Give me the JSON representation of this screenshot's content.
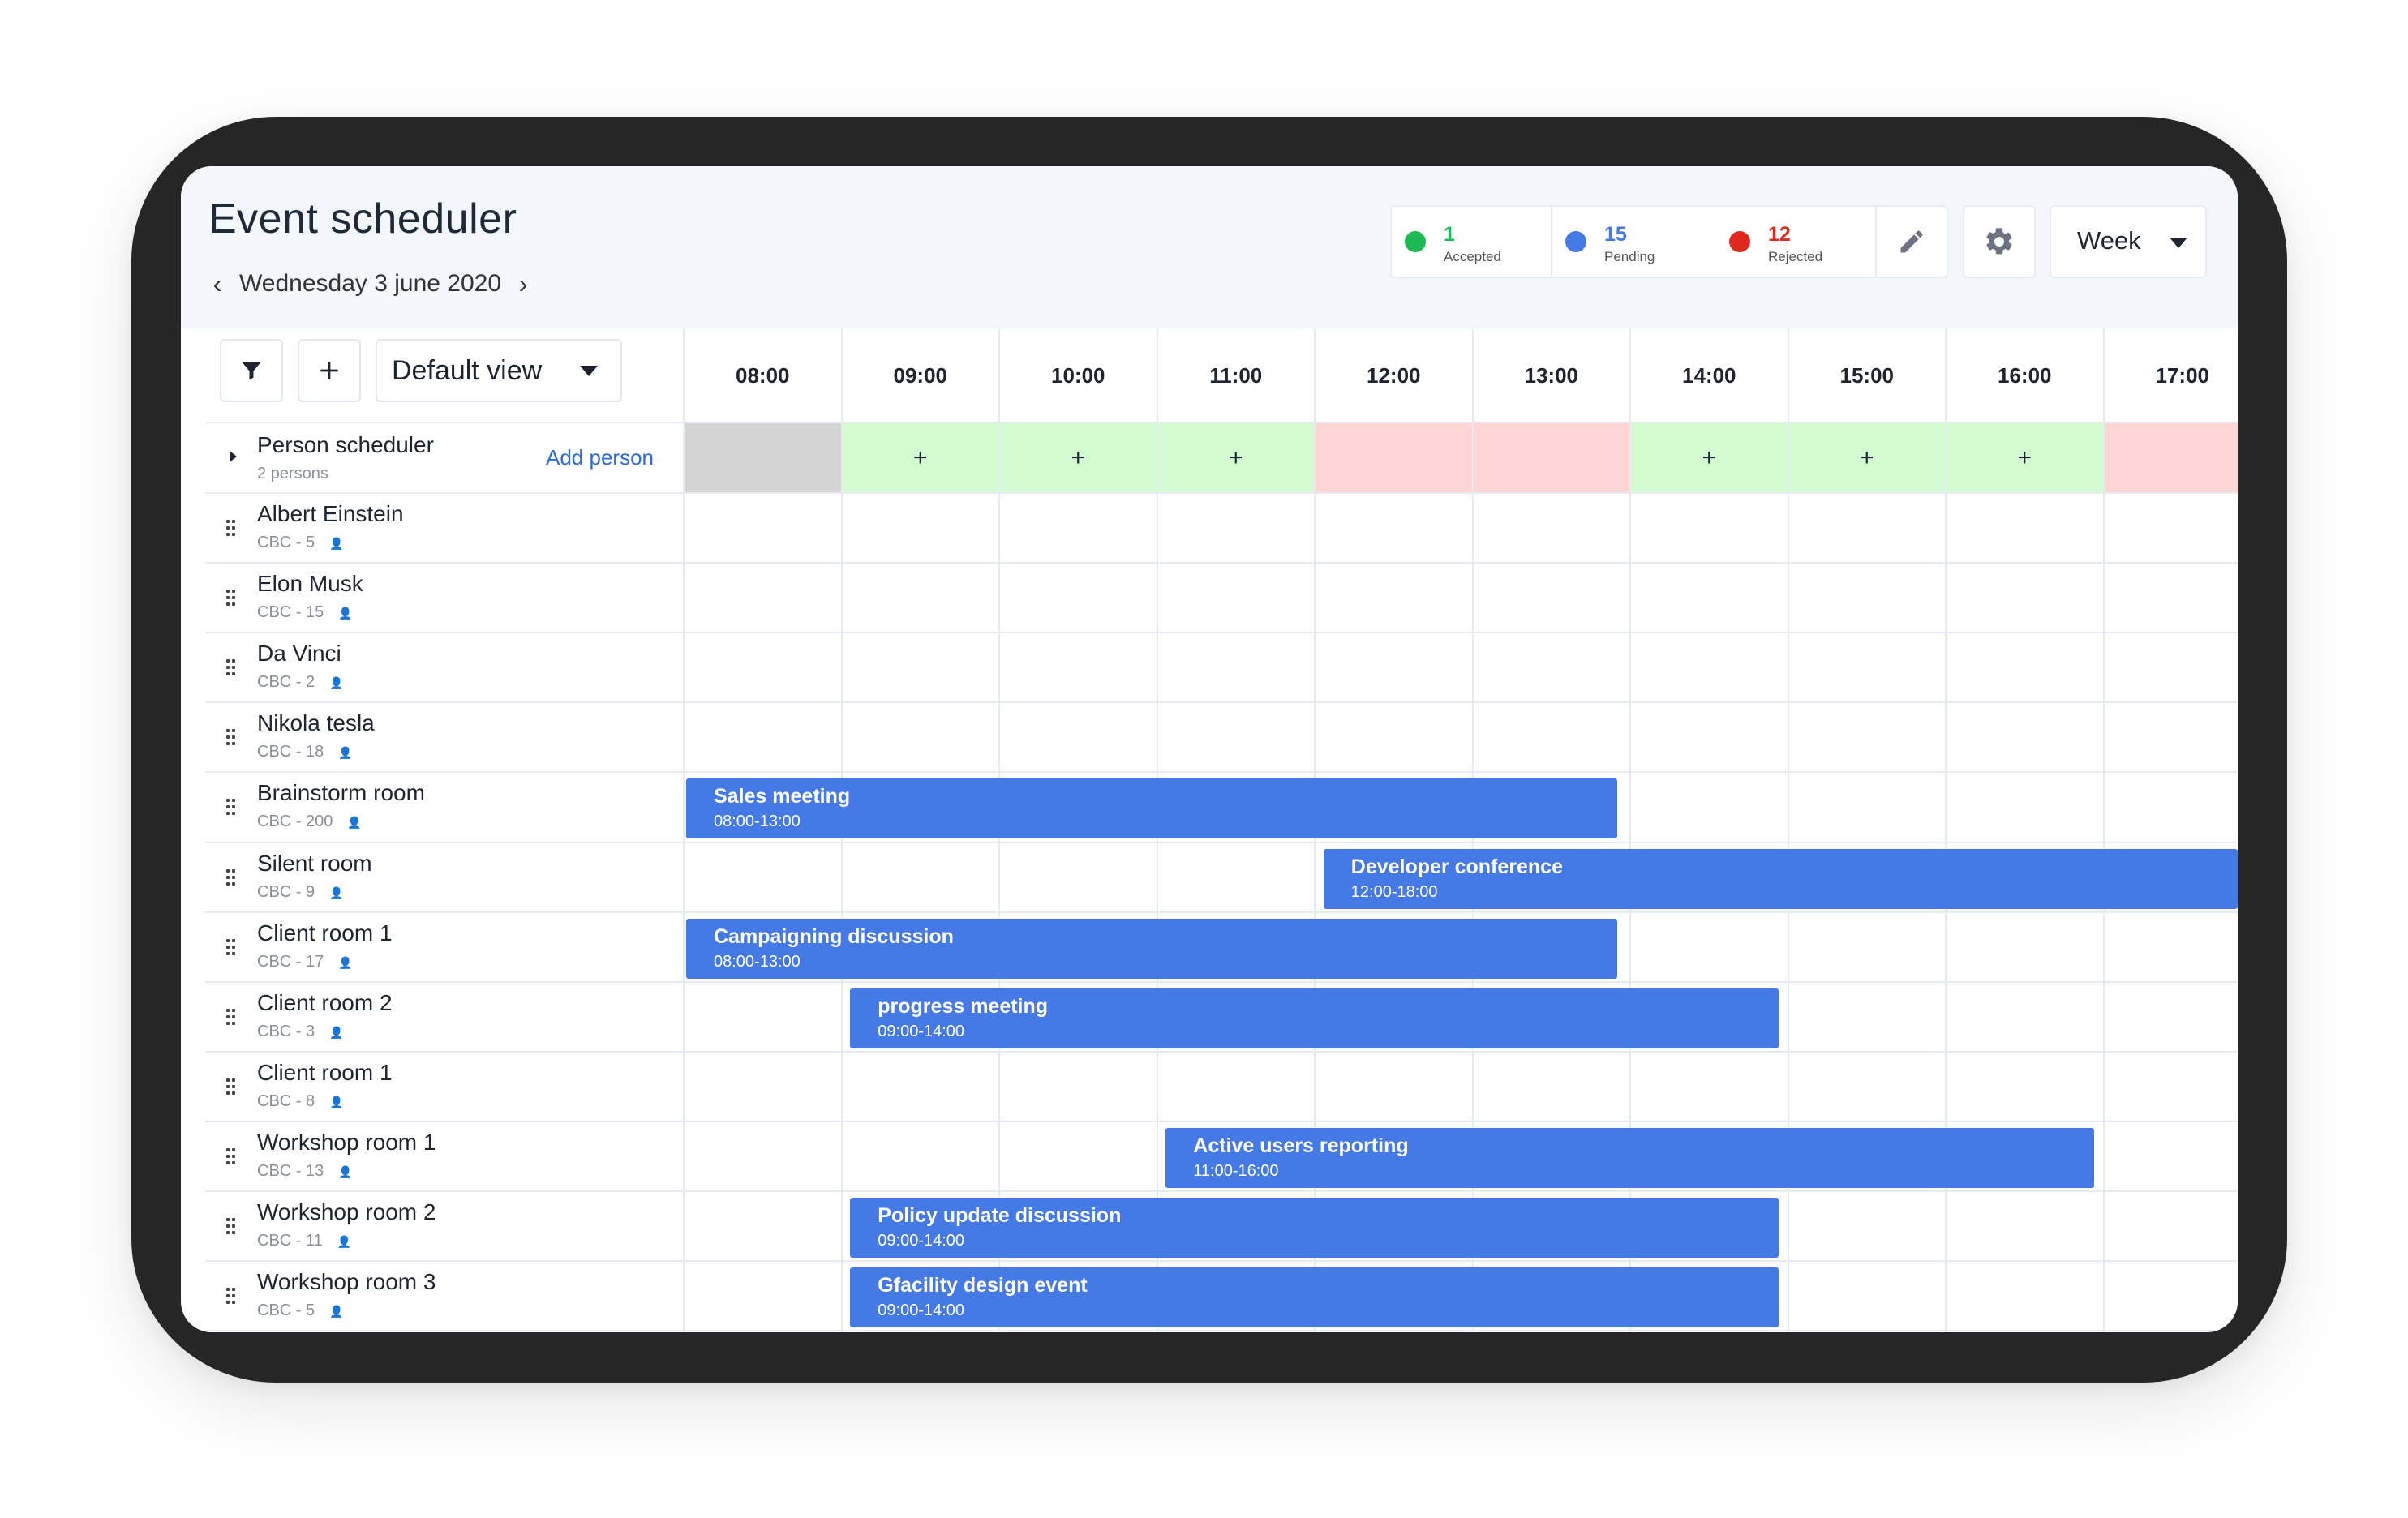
{
  "app": {
    "title": "Event scheduler",
    "date_label": "Wednesday 3 june 2020",
    "prev_icon": "chevron-left-icon",
    "next_icon": "chevron-right-icon"
  },
  "status": {
    "accepted": {
      "count": "1",
      "label": "Accepted",
      "color": "#1db954"
    },
    "pending": {
      "count": "15",
      "label": "Pending",
      "color": "#4479e6"
    },
    "rejected": {
      "count": "12",
      "label": "Rejected",
      "color": "#e0281f"
    }
  },
  "toolbar": {
    "edit_icon": "pencil-icon",
    "settings_icon": "gear-icon",
    "range_selected": "Week",
    "filter_icon": "filter-icon",
    "add_icon": "plus-icon",
    "view_selected": "Default view"
  },
  "hours": [
    "08:00",
    "09:00",
    "10:00",
    "11:00",
    "12:00",
    "13:00",
    "14:00",
    "15:00",
    "16:00",
    "17:00"
  ],
  "person_scheduler": {
    "title": "Person scheduler",
    "subtitle": "2 persons",
    "add_label": "Add person",
    "availability": [
      "blocked",
      "open",
      "open",
      "open",
      "busy",
      "busy",
      "open",
      "open",
      "open",
      "busy"
    ],
    "open_symbol": "+",
    "colors": {
      "blocked": "#d4d4d4",
      "open": "#d2fbd1",
      "busy": "#fdd5d5"
    }
  },
  "resources": [
    {
      "name": "Albert Einstein",
      "sub": "CBC - 5"
    },
    {
      "name": "Elon Musk",
      "sub": "CBC - 15"
    },
    {
      "name": "Da Vinci",
      "sub": "CBC - 2"
    },
    {
      "name": "Nikola tesla",
      "sub": "CBC - 18"
    },
    {
      "name": "Brainstorm room",
      "sub": "CBC - 200"
    },
    {
      "name": "Silent room",
      "sub": "CBC - 9"
    },
    {
      "name": "Client room 1",
      "sub": "CBC - 17"
    },
    {
      "name": "Client room 2",
      "sub": "CBC - 3"
    },
    {
      "name": "Client room 1",
      "sub": "CBC - 8"
    },
    {
      "name": "Workshop room 1",
      "sub": "CBC - 13"
    },
    {
      "name": "Workshop room 2",
      "sub": "CBC - 11"
    },
    {
      "name": "Workshop room 3",
      "sub": "CBC - 5"
    }
  ],
  "events": [
    {
      "row": 4,
      "start": 8,
      "end": 13.92,
      "title": "Sales meeting",
      "time": "08:00-13:00"
    },
    {
      "row": 5,
      "start": 12.04,
      "end": 18,
      "title": "Developer conference",
      "time": "12:00-18:00"
    },
    {
      "row": 6,
      "start": 8,
      "end": 13.92,
      "title": "Campaigning discussion",
      "time": "08:00-13:00"
    },
    {
      "row": 7,
      "start": 9.04,
      "end": 14.94,
      "title": "progress meeting",
      "time": "09:00-14:00"
    },
    {
      "row": 9,
      "start": 11.04,
      "end": 16.94,
      "title": "Active users reporting",
      "time": "11:00-16:00"
    },
    {
      "row": 10,
      "start": 9.04,
      "end": 14.94,
      "title": "Policy update discussion",
      "time": "09:00-14:00"
    },
    {
      "row": 11,
      "start": 9.04,
      "end": 14.94,
      "title": "Gfacility design event",
      "time": "09:00-14:00"
    }
  ]
}
